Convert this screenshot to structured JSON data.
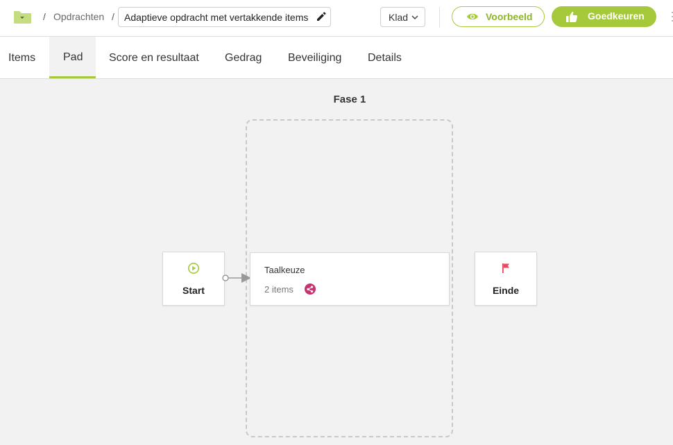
{
  "header": {
    "breadcrumb_separator": "/",
    "breadcrumb_label": "Opdrachten",
    "title": "Adaptieve opdracht met vertakkende items",
    "status": "Klad",
    "preview_label": "Voorbeeld",
    "approve_label": "Goedkeuren"
  },
  "tabs": [
    {
      "label": "Items"
    },
    {
      "label": "Pad"
    },
    {
      "label": "Score en resultaat"
    },
    {
      "label": "Gedrag"
    },
    {
      "label": "Beveiliging"
    },
    {
      "label": "Details"
    }
  ],
  "active_tab": "Pad",
  "flow": {
    "phase_title": "Fase 1",
    "start_label": "Start",
    "end_label": "Einde",
    "item_title": "Taalkeuze",
    "item_count": "2 items"
  },
  "colors": {
    "accent": "#a5c93a",
    "branch_icon": "#c8336f",
    "end_flag": "#e84a5f",
    "folder": "#c5dc80"
  },
  "icons": {
    "folder": "folder-icon",
    "edit": "pencil-icon",
    "status_dropdown": "chevron-down-icon",
    "preview": "eye-icon",
    "approve": "thumbs-up-icon",
    "start": "play-circle-icon",
    "end": "flag-icon",
    "branch": "branch-icon",
    "more": "more-icon"
  }
}
